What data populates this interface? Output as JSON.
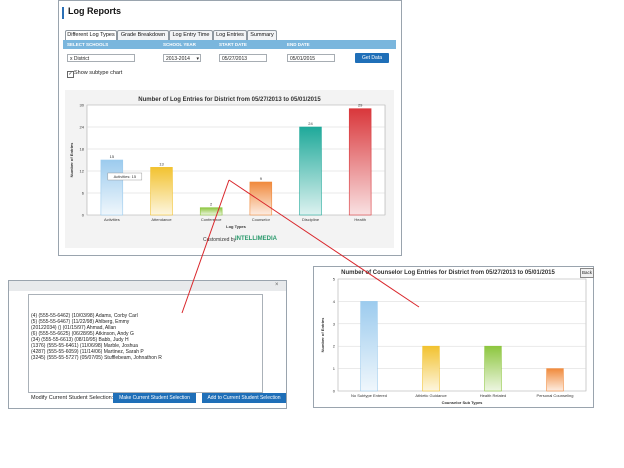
{
  "main": {
    "title": "Log Reports",
    "tabs": [
      "Different Log Types",
      "Grade Breakdown",
      "Log Entry Time",
      "Log Entries",
      "Summary"
    ],
    "active_tab": 0,
    "headers": {
      "schools": "SELECT SCHOOLS",
      "year": "SCHOOL YEAR",
      "start": "START DATE",
      "end": "END DATE"
    },
    "school_value": "x District",
    "year_value": "2013-2014",
    "start_date": "05/27/2013",
    "end_date": "05/01/2015",
    "get_data": "Get Data",
    "show_subtype": "Show subtype chart",
    "powered_by": "Customized by",
    "brand": "INTELLIMEDIA"
  },
  "chart_data": [
    {
      "type": "bar",
      "title": "Number of Log Entries for District from 05/27/2013 to 05/01/2015",
      "xlabel": "Log Types",
      "ylabel": "Number of Entries",
      "categories": [
        "Activities",
        "Attendance",
        "Conference",
        "Counselor",
        "Discipline",
        "Health"
      ],
      "values": [
        15,
        13,
        2,
        9,
        24,
        29
      ],
      "ylim": [
        0,
        30
      ],
      "yticks": [
        0,
        6,
        12,
        18,
        24,
        30
      ],
      "colors": [
        "#9ccbee",
        "#f2c230",
        "#8dc63f",
        "#f08a3c",
        "#1fa99a",
        "#d9373b"
      ],
      "tooltip": "Activities: 15",
      "grid": true
    },
    {
      "type": "bar",
      "title": "Number of Counselor Log Entries for District from 05/27/2013 to 05/01/2015",
      "xlabel": "Counselor Sub Types",
      "ylabel": "Number of Entries",
      "categories": [
        "No Subtype Entered",
        "Athletic Guidance",
        "Health Related",
        "Personal Counseling"
      ],
      "values": [
        4,
        2,
        2,
        1
      ],
      "ylim": [
        0,
        5
      ],
      "yticks": [
        0,
        1,
        2,
        3,
        4,
        5
      ],
      "colors": [
        "#9ccbee",
        "#f2c230",
        "#8dc63f",
        "#f08a3c"
      ],
      "grid": true
    }
  ],
  "popup": {
    "students": [
      "(4) (555-55-6462) (10/03/98) Adams, Corby Carl",
      "(5) (555-55-6467) (11/22/98) Ahlberg, Emmy",
      "(20122034) () (01/15/97) Ahmad, Allan",
      "(6) (555-55-6625) (06/28/95) Atkinson, Andy G",
      "(34) (555-55-6613) (08/10/95) Babb, Judy H",
      "(1376) (555-55-6461) (11/06/98) Marble, Joshua",
      "(4287) (555-55-6059) (11/14/06) Martinez, Sarah P",
      "(3245) (555-55-5727) (05/07/05) Stufflebeam, Johnathon R"
    ],
    "modify_label": "Modify Current Student Selection:",
    "make_button": "Make Current Student Selection",
    "add_button": "Add to Current Student Selection",
    "close": "×"
  },
  "counselor": {
    "back": "Back"
  }
}
